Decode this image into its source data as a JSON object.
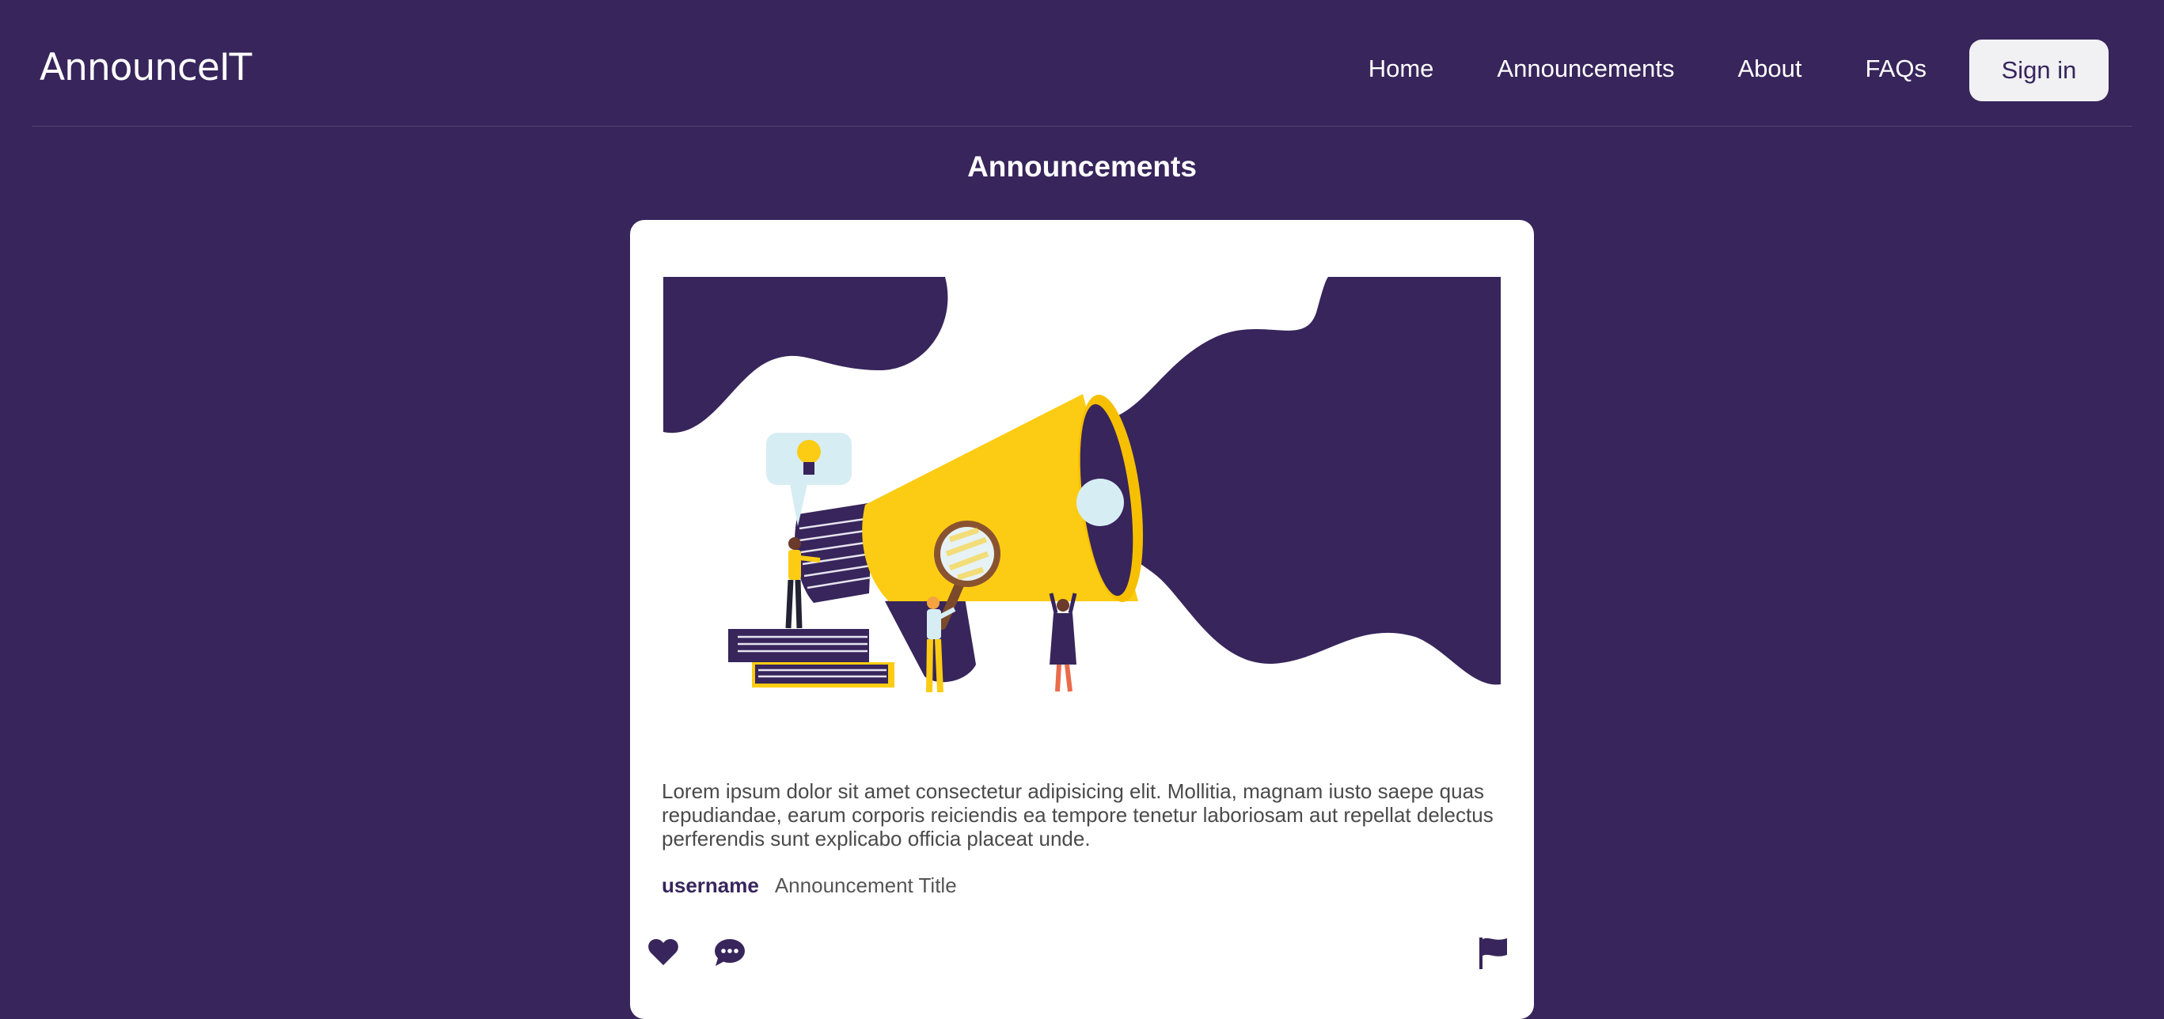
{
  "app": {
    "name": "AnnounceIT"
  },
  "nav": {
    "links": [
      "Home",
      "Announcements",
      "About",
      "FAQs"
    ],
    "signin_label": "Sign in"
  },
  "page": {
    "title": "Announcements"
  },
  "announcement": {
    "body": "Lorem ipsum dolor sit amet consectetur adipisicing elit. Mollitia, magnam iusto saepe quas repudiandae, earum corporis reiciendis ea tempore tenetur laboriosam aut repellat delectus perferendis sunt explicabo officia placeat unde.",
    "username": "username",
    "title": "Announcement Title",
    "actions": {
      "like_icon": "heart-icon",
      "comment_icon": "comment-icon",
      "report_icon": "flag-icon"
    }
  },
  "colors": {
    "brand": "#37255b",
    "accent_yellow": "#fccc14",
    "card_bg": "#ffffff",
    "light_blue": "#d7edf4"
  }
}
